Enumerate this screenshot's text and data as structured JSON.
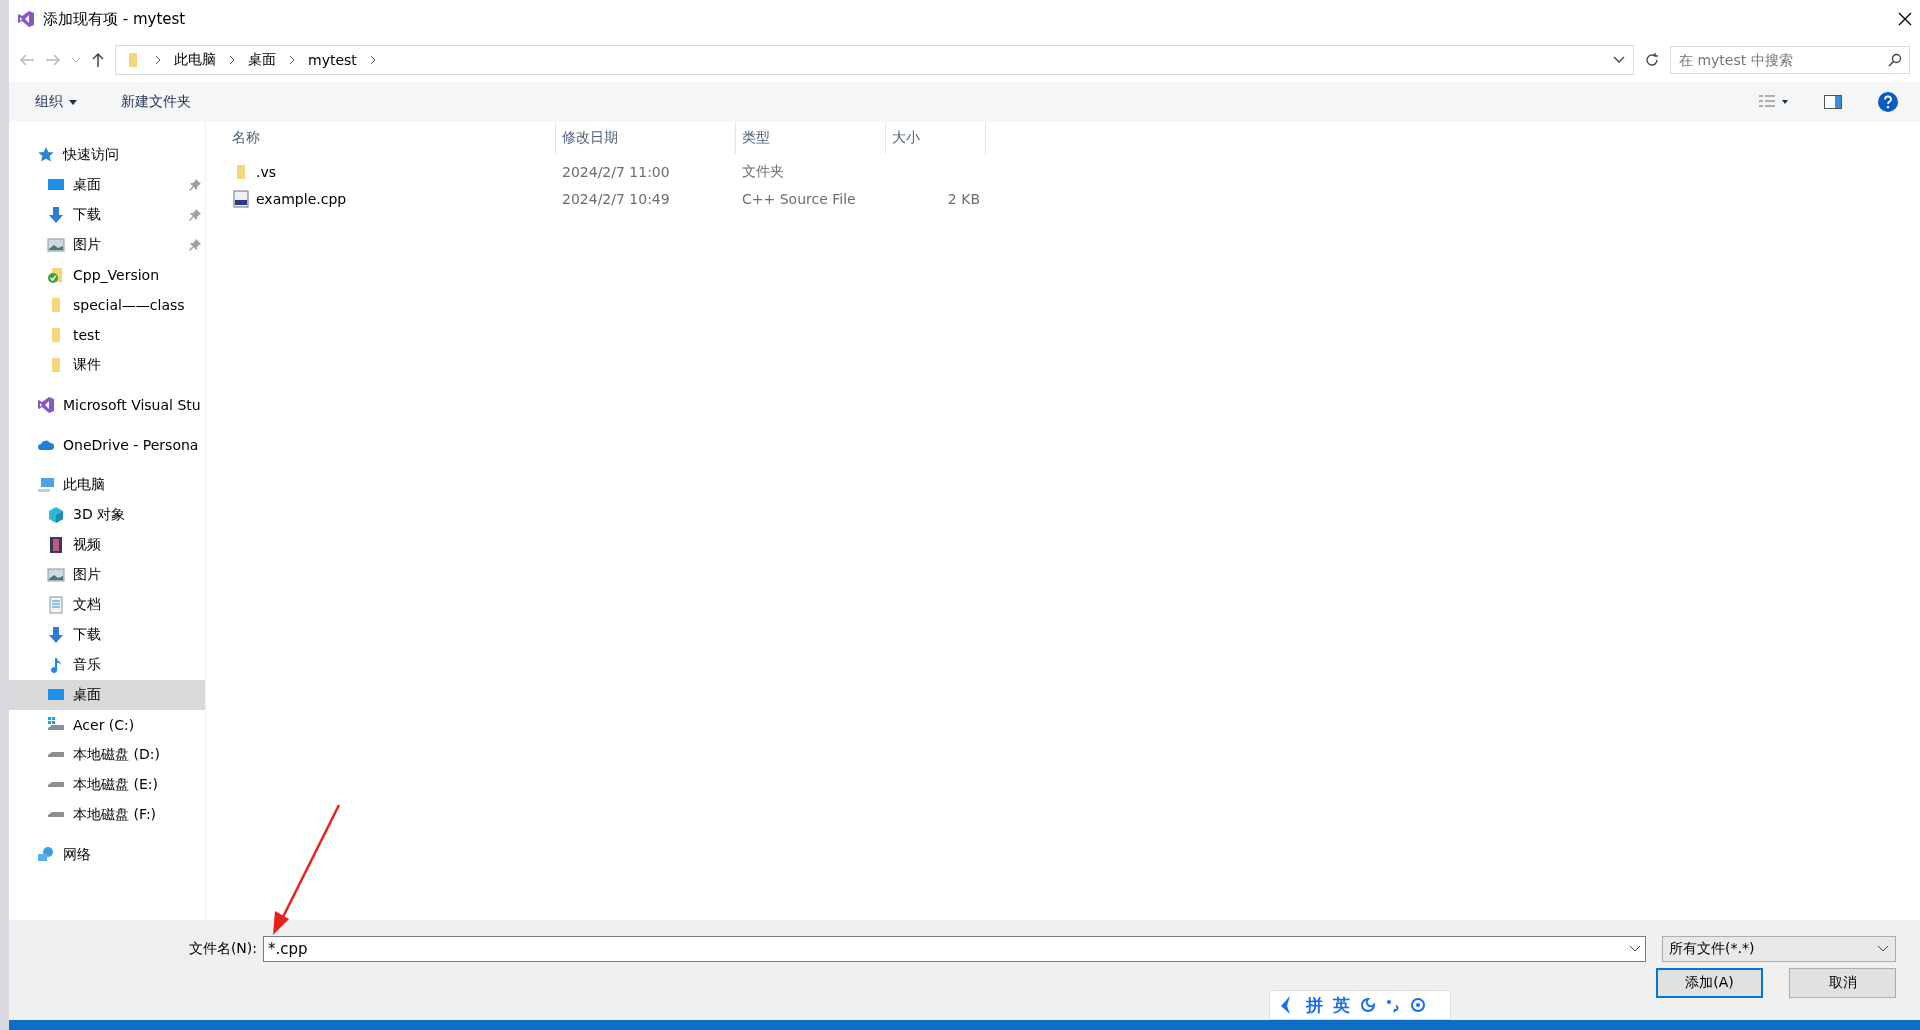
{
  "window": {
    "title": "添加现有项 - mytest"
  },
  "address_bar": {
    "crumbs": [
      "此电脑",
      "桌面",
      "mytest"
    ]
  },
  "search": {
    "placeholder": "在 mytest 中搜索"
  },
  "toolbar": {
    "organize": "组织",
    "new_folder": "新建文件夹"
  },
  "sidebar": {
    "items": [
      {
        "label": "快速访问",
        "kind": "star",
        "selected": false,
        "children": [
          {
            "label": "桌面",
            "kind": "desktop",
            "pinned": true,
            "selected": false
          },
          {
            "label": "下载",
            "kind": "download",
            "pinned": true,
            "selected": false
          },
          {
            "label": "图片",
            "kind": "picture",
            "pinned": true,
            "selected": false
          },
          {
            "label": "Cpp_Version",
            "kind": "synced-folder",
            "pinned": false,
            "selected": false
          },
          {
            "label": "special——class",
            "kind": "folder",
            "pinned": false,
            "selected": false
          },
          {
            "label": "test",
            "kind": "folder",
            "pinned": false,
            "selected": false
          },
          {
            "label": "课件",
            "kind": "folder",
            "pinned": false,
            "selected": false
          }
        ]
      },
      {
        "label": "Microsoft Visual Stu",
        "kind": "vs",
        "selected": false
      },
      {
        "label": "OneDrive - Persona",
        "kind": "cloud",
        "selected": false
      },
      {
        "label": "此电脑",
        "kind": "computer",
        "selected": false,
        "children": [
          {
            "label": "3D 对象",
            "kind": "cube",
            "pinned": false,
            "selected": false
          },
          {
            "label": "视频",
            "kind": "video",
            "pinned": false,
            "selected": false
          },
          {
            "label": "图片",
            "kind": "picture",
            "pinned": false,
            "selected": false
          },
          {
            "label": "文档",
            "kind": "document",
            "pinned": false,
            "selected": false
          },
          {
            "label": "下载",
            "kind": "download",
            "pinned": false,
            "selected": false
          },
          {
            "label": "音乐",
            "kind": "music",
            "pinned": false,
            "selected": false
          },
          {
            "label": "桌面",
            "kind": "desktop",
            "pinned": false,
            "selected": true
          },
          {
            "label": "Acer (C:)",
            "kind": "system-drive",
            "pinned": false,
            "selected": false
          },
          {
            "label": "本地磁盘 (D:)",
            "kind": "drive",
            "pinned": false,
            "selected": false
          },
          {
            "label": "本地磁盘 (E:)",
            "kind": "drive",
            "pinned": false,
            "selected": false
          },
          {
            "label": "本地磁盘 (F:)",
            "kind": "drive",
            "pinned": false,
            "selected": false
          }
        ]
      },
      {
        "label": "网络",
        "kind": "network",
        "selected": false
      }
    ]
  },
  "file_list": {
    "columns": [
      "名称",
      "修改日期",
      "类型",
      "大小"
    ],
    "rows": [
      {
        "name": ".vs",
        "kind": "folder",
        "modified": "2024/2/7 11:00",
        "type": "文件夹",
        "selected": false
      },
      {
        "name": "example.cpp",
        "kind": "cpp",
        "modified": "2024/2/7 10:49",
        "type": "C++ Source File",
        "size": "2 KB",
        "selected": false
      }
    ]
  },
  "footer": {
    "filename_label": "文件名(N):",
    "filename_value": "*.cpp",
    "filter": "所有文件(*.*)",
    "add_button": "添加(A)",
    "cancel_button": "取消"
  },
  "ime_bar": {
    "items": [
      "拼",
      "英"
    ]
  }
}
